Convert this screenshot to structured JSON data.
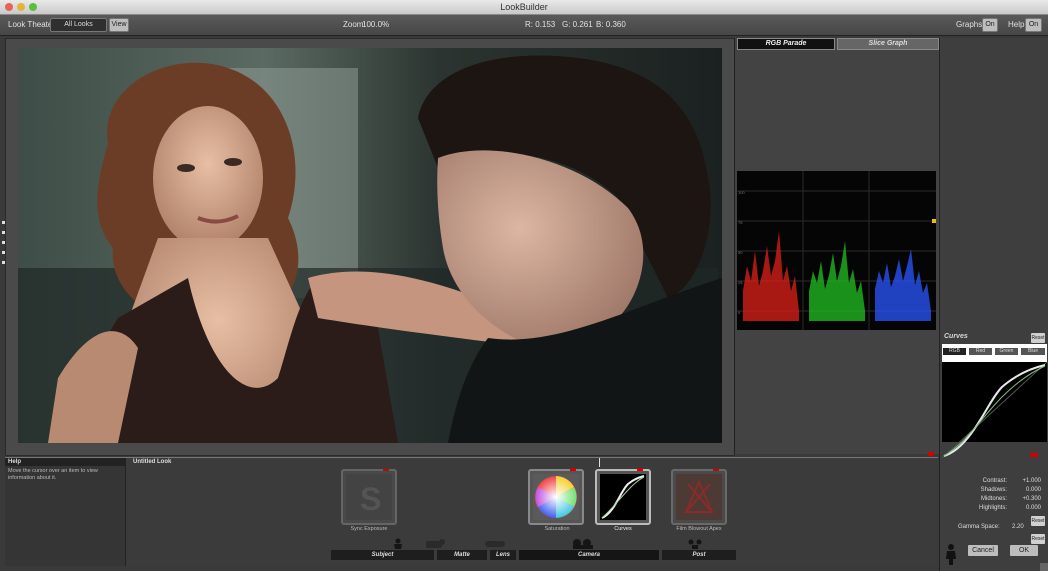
{
  "window": {
    "title": "LookBuilder"
  },
  "toolbar": {
    "look_theater_label": "Look Theater:",
    "look_theater_value": "All Looks",
    "view_button": "View",
    "zoom_label": "Zoom:",
    "zoom_value": "100.0%",
    "readout_r": "R: 0.153",
    "readout_g": "G: 0.261",
    "readout_b": "B: 0.360",
    "graphs_label": "Graphs:",
    "graphs_toggle": "On",
    "help_label": "Help:",
    "help_toggle": "On"
  },
  "scopes": {
    "tabs": [
      "RGB Parade",
      "Slice Graph"
    ],
    "active_tab": 0
  },
  "curves": {
    "title": "Curves",
    "reset": "Reset",
    "channels": [
      "RGB",
      "Red",
      "Green",
      "Blue"
    ],
    "params": [
      {
        "label": "Contrast:",
        "value": "+1.000"
      },
      {
        "label": "Shadows:",
        "value": "0.000"
      },
      {
        "label": "Midtones:",
        "value": "+0.300"
      },
      {
        "label": "Highlights:",
        "value": "0.000"
      }
    ],
    "reset2": "Reset",
    "gamma_label": "Gamma Space:",
    "gamma_value": "2.20",
    "reset3": "Reset",
    "cancel": "Cancel",
    "ok": "OK"
  },
  "help": {
    "title": "Help",
    "text": "Move the cursor over an item to view information about it."
  },
  "look": {
    "title": "Untitled Look",
    "tools": [
      {
        "label": "Sync Exposure"
      },
      {
        "label": "Saturation"
      },
      {
        "label": "Curves"
      },
      {
        "label": "Film Blowout Apex"
      }
    ],
    "stages": [
      "Subject",
      "Matte",
      "Lens",
      "Camera",
      "Post"
    ],
    "selected_stage": "Camera"
  },
  "colors": {
    "accent_red": "#d40000",
    "scope_red": "#e0201a",
    "scope_green": "#22c022",
    "scope_blue": "#2a55ff"
  }
}
